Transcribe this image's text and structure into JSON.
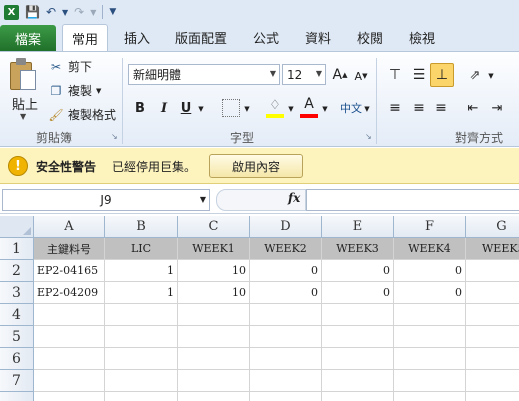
{
  "quick_access": {
    "app_icon": "X",
    "save_icon": "save-icon",
    "undo_icon": "undo-icon",
    "redo_icon": "redo-icon",
    "customize_icon": "customize-qat-icon"
  },
  "tabs": {
    "file": "檔案",
    "items": [
      "常用",
      "插入",
      "版面配置",
      "公式",
      "資料",
      "校閱",
      "檢視"
    ],
    "active": "常用"
  },
  "ribbon": {
    "clipboard": {
      "paste_label": "貼上",
      "cut_label": "剪下",
      "copy_label": "複製",
      "format_painter_label": "複製格式",
      "group_label": "剪貼簿"
    },
    "font": {
      "font_name": "新細明體",
      "font_size": "12",
      "grow_label": "A",
      "shrink_label": "A",
      "bold": "B",
      "italic": "I",
      "underline": "U",
      "group_label": "字型",
      "fill_color": "#ffff00",
      "font_color": "#ff0000"
    },
    "alignment": {
      "group_label": "對齊方式"
    }
  },
  "security_bar": {
    "title": "安全性警告",
    "message": "已經停用巨集。",
    "button_label": "啟用內容"
  },
  "formula_bar": {
    "name_box": "J9",
    "fx_label": "fx",
    "formula": ""
  },
  "sheet": {
    "columns": [
      "A",
      "B",
      "C",
      "D",
      "E",
      "F",
      "G"
    ],
    "rows": [
      "1",
      "2",
      "3",
      "4",
      "5",
      "6",
      "7"
    ],
    "header_row": [
      "主鍵料号",
      "LIC",
      "WEEK1",
      "WEEK2",
      "WEEK3",
      "WEEK4",
      "WEEK5"
    ],
    "data_rows": [
      [
        "EP2-04165",
        "1",
        "10",
        "0",
        "0",
        "0",
        ""
      ],
      [
        "EP2-04209",
        "1",
        "10",
        "0",
        "0",
        "0",
        ""
      ]
    ]
  }
}
